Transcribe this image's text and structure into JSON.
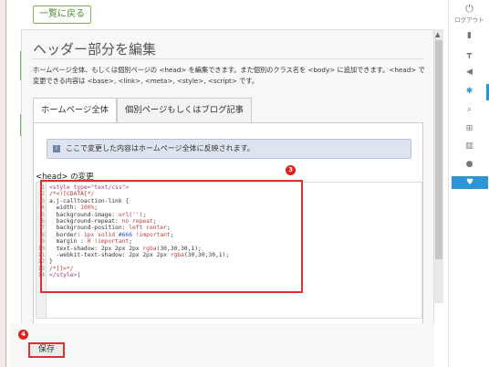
{
  "topbar": {
    "back_label": "一覧に戻る"
  },
  "panel": {
    "title": "ヘッダー部分を編集",
    "description": "ホームページ全体、もしくは個別ページの <head> を編集できます。また個別のクラス名を <body> に追加できます。<head> で変更できる内容は <base>, <link>, <meta>, <style>, <script> です。",
    "tabs": [
      {
        "label": "ホームページ全体",
        "active": true
      },
      {
        "label": "個別ページもしくはブログ記事",
        "active": false
      }
    ],
    "notice": "ここで変更した内容はホームページ全体に反映されます。",
    "head_label": "<head> の変更",
    "line_numbers": "1\n2\n3\n4\n5\n6\n7\n8\n9\n10\n11\n12\n13\n14",
    "save_label": "保存"
  },
  "badges": {
    "editor": "3",
    "save": "4"
  },
  "sidebar": {
    "logout_label": "ログアウト",
    "items": [
      {
        "icon": "power-icon"
      },
      {
        "icon": "brush-icon"
      },
      {
        "icon": "paint-roller-icon"
      },
      {
        "icon": "megaphone-icon"
      },
      {
        "icon": "gear-icon",
        "active": true
      },
      {
        "icon": "search-icon"
      },
      {
        "icon": "cart-icon"
      },
      {
        "icon": "bar-chart-icon"
      },
      {
        "icon": "help-icon"
      },
      {
        "icon": "heart-icon"
      }
    ]
  },
  "colors": {
    "accent": "#2b95d6",
    "highlight": "#e03030",
    "green": "#6fb44a"
  }
}
